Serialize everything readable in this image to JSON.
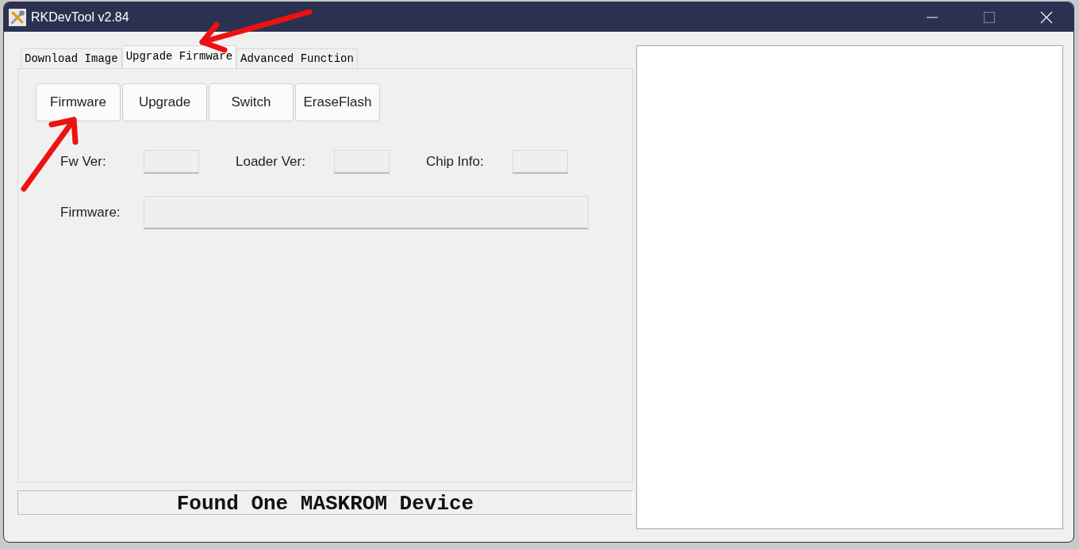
{
  "window": {
    "title": "RKDevTool v2.84",
    "controls": [
      {
        "kind": "minimize",
        "disabled": false
      },
      {
        "kind": "maximize",
        "disabled": true
      },
      {
        "kind": "close",
        "disabled": false
      }
    ]
  },
  "tabs": [
    {
      "label": "Download Image",
      "selected": false
    },
    {
      "label": "Upgrade Firmware",
      "selected": true
    },
    {
      "label": "Advanced Function",
      "selected": false
    }
  ],
  "buttons": [
    "Firmware",
    "Upgrade",
    "Switch",
    "EraseFlash"
  ],
  "info_rows": [
    [
      {
        "label": "Fw Ver:",
        "kind": "short"
      },
      {
        "label": "Loader Ver:",
        "kind": "short"
      },
      {
        "label": "Chip Info:",
        "kind": "short"
      }
    ],
    [
      {
        "label": "Firmware:",
        "kind": "wide"
      }
    ]
  ],
  "status_bar": "Found One MASKROM Device"
}
